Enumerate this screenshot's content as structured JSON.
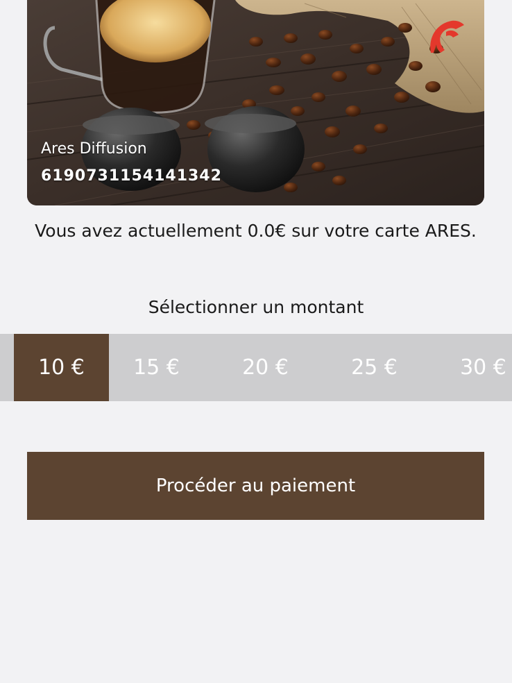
{
  "card": {
    "holder_name": "Ares Diffusion",
    "card_number": "6190731154141342",
    "image_subject": "coffee-cup-capsules-and-beans",
    "logo_color": "#e4382c"
  },
  "balance": {
    "message": "Vous avez actuellement 0.0€ sur votre carte ARES."
  },
  "amount_selector": {
    "label": "Sélectionner un montant",
    "selected_value": "10 €",
    "options": [
      {
        "label": "10 €",
        "selected": true
      },
      {
        "label": "15 €",
        "selected": false
      },
      {
        "label": "20 €",
        "selected": false
      },
      {
        "label": "25 €",
        "selected": false
      },
      {
        "label": "30 €",
        "selected": false
      }
    ]
  },
  "actions": {
    "pay_label": "Procéder au paiement"
  },
  "colors": {
    "accent_brown": "#5c4431",
    "selector_background": "#cdcdcf",
    "page_background": "#f2f2f4",
    "text": "#1a1a1a"
  }
}
